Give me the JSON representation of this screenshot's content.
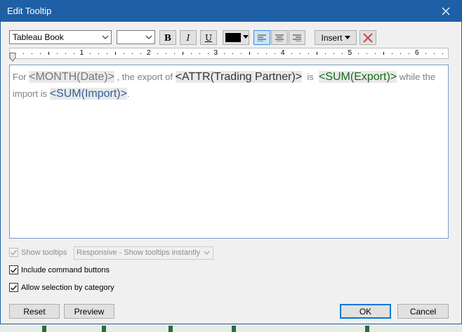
{
  "window": {
    "title": "Edit Tooltip"
  },
  "toolbar": {
    "font": "Tableau Book",
    "font_size": "",
    "bold_label": "B",
    "italic_label": "I",
    "underline_label": "U",
    "text_color": "#000000",
    "insert_label": "Insert"
  },
  "ruler": {
    "numbers": [
      "1",
      "2",
      "3",
      "4",
      "5",
      "6"
    ]
  },
  "editor": {
    "segments": [
      {
        "text": "For ",
        "kind": "plain"
      },
      {
        "text": "<MONTH(Date)>",
        "kind": "field",
        "color": "#777777"
      },
      {
        "text": " , the export of ",
        "kind": "plain"
      },
      {
        "text": "<ATTR(Trading Partner)>",
        "kind": "field",
        "color": "#333333"
      },
      {
        "text": "  is  ",
        "kind": "plain"
      },
      {
        "text": "<SUM(Export)>",
        "kind": "field",
        "color": "#1a6b1a"
      },
      {
        "text": " while the import is ",
        "kind": "plain"
      },
      {
        "text": "<SUM(Import)>",
        "kind": "field",
        "color": "#2f5f96"
      },
      {
        "text": ".",
        "kind": "plain"
      }
    ]
  },
  "options": {
    "show_tooltips": {
      "label": "Show tooltips",
      "checked": true,
      "enabled": false
    },
    "tooltip_mode": "Responsive - Show tooltips instantly",
    "include_command_buttons": {
      "label": "Include command buttons",
      "checked": true
    },
    "allow_selection": {
      "label": "Allow selection by category",
      "checked": true
    }
  },
  "buttons": {
    "reset": "Reset",
    "preview": "Preview",
    "ok": "OK",
    "cancel": "Cancel"
  },
  "colors": {
    "titlebar": "#1f5fa6",
    "accent": "#0078d7",
    "clear_x": "#d04545"
  }
}
